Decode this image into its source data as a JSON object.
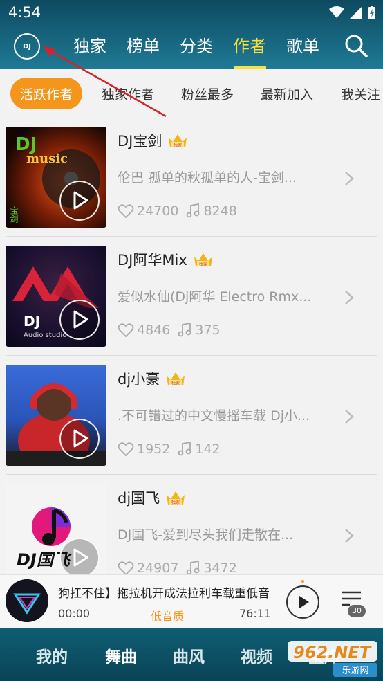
{
  "status_bar": {
    "time": "4:54"
  },
  "header": {
    "logo_text": "DJ",
    "tabs": [
      {
        "label": "独家",
        "active": false
      },
      {
        "label": "榜单",
        "active": false
      },
      {
        "label": "分类",
        "active": false
      },
      {
        "label": "作者",
        "active": true
      },
      {
        "label": "歌单",
        "active": false
      }
    ],
    "search_icon": "search-icon",
    "active_color": "#f6e23a"
  },
  "chips": [
    {
      "label": "活跃作者",
      "active": true
    },
    {
      "label": "独家作者",
      "active": false
    },
    {
      "label": "粉丝最多",
      "active": false
    },
    {
      "label": "最新加入",
      "active": false
    },
    {
      "label": "我关注",
      "active": false
    }
  ],
  "accent_color": "#f4961c",
  "badge_text": "独家",
  "artists": [
    {
      "name": "DJ宝剑",
      "desc": "伦巴   孤单的秋孤单的人-宝剑...",
      "likes": "24700",
      "songs": "8248",
      "cover_texts": [
        "DJ",
        "music",
        "宝剑"
      ]
    },
    {
      "name": "DJ阿华Mix",
      "desc": "爱似水仙(Dj阿华 Electro Rmx...",
      "likes": "4846",
      "songs": "375",
      "cover_texts": [
        "DJ",
        "Audio studio"
      ]
    },
    {
      "name": "dj小豪",
      "desc": ".不可错过的中文慢摇车载 Dj小...",
      "likes": "1952",
      "songs": "142",
      "cover_texts": []
    },
    {
      "name": "dj国飞",
      "desc": "DJ国飞-爱到尽头我们走散在...",
      "likes": "24907",
      "songs": "3472",
      "cover_texts": [
        "DJ国飞"
      ]
    }
  ],
  "player": {
    "title": "狗扛不住】拖拉机开成法拉利车载重低音",
    "current_time": "00:00",
    "quality": "低音质",
    "total_time": "76:11",
    "playlist_count": "30"
  },
  "bottom_nav": [
    {
      "label": "我的",
      "active": false
    },
    {
      "label": "舞曲",
      "active": true
    },
    {
      "label": "曲风",
      "active": false
    },
    {
      "label": "视频",
      "active": false
    },
    {
      "label": "宝库",
      "active": false
    }
  ],
  "watermark": {
    "brand": "962.NET",
    "sub": "乐游网"
  }
}
